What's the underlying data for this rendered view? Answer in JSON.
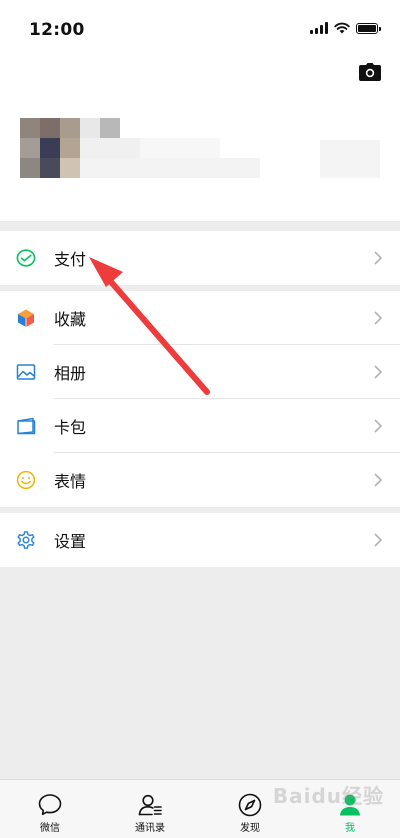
{
  "status_bar": {
    "time": "12:00"
  },
  "menu": {
    "pay": {
      "label": "支付"
    },
    "favorites": {
      "label": "收藏"
    },
    "album": {
      "label": "相册"
    },
    "cards": {
      "label": "卡包"
    },
    "stickers": {
      "label": "表情"
    },
    "settings": {
      "label": "设置"
    }
  },
  "tabbar": {
    "items": [
      {
        "label": "微信"
      },
      {
        "label": "通讯录"
      },
      {
        "label": "发现"
      },
      {
        "label": "我"
      }
    ],
    "active_index": 3
  },
  "colors": {
    "accent": "#07c160",
    "pay_green": "#07c160",
    "arrow_red": "#ee3b3b",
    "background": "#ededed"
  },
  "watermark": "Baidu经验",
  "icons": [
    "camera-icon",
    "pay-icon",
    "favorites-icon",
    "album-icon",
    "cards-icon",
    "stickers-icon",
    "settings-icon",
    "chevron-right-icon",
    "chat-icon",
    "contacts-icon",
    "discover-icon",
    "me-icon"
  ]
}
